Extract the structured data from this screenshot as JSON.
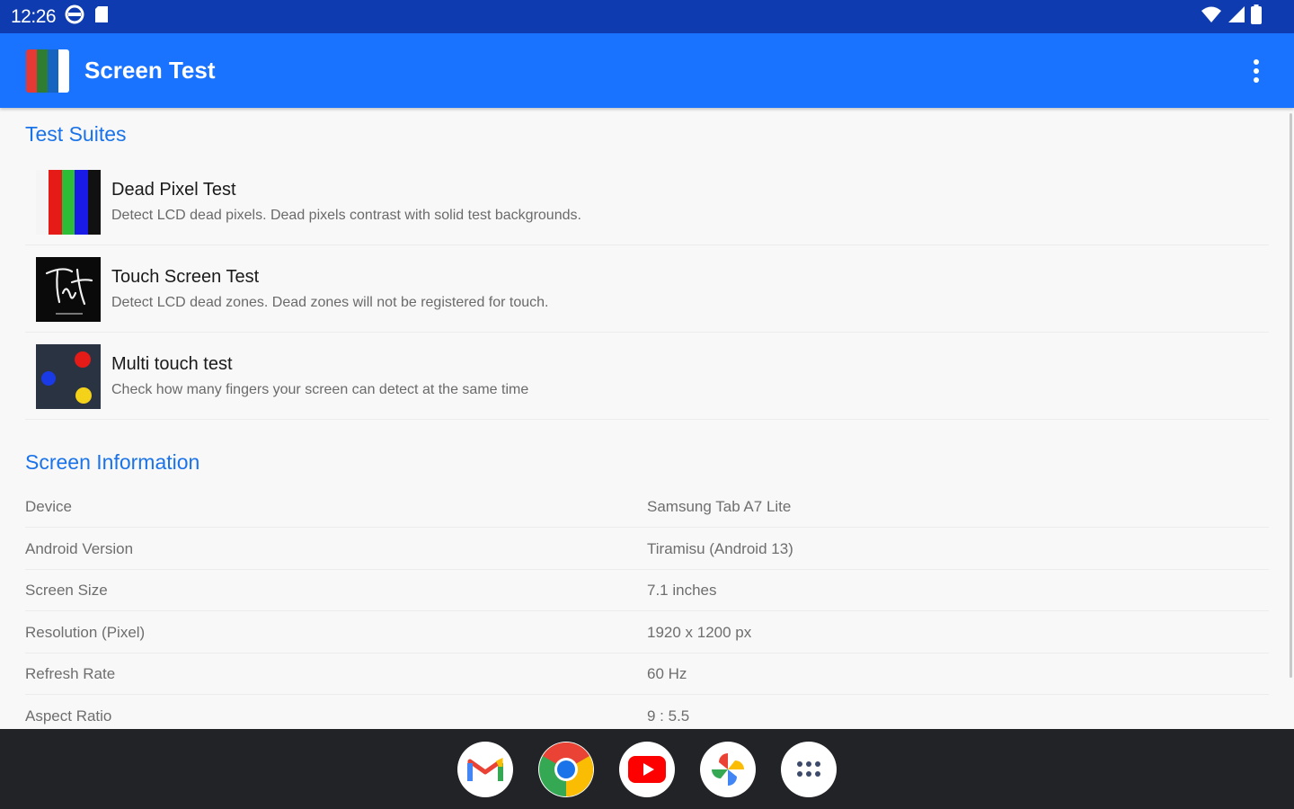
{
  "status_bar": {
    "time": "12:26"
  },
  "app_bar": {
    "title": "Screen Test",
    "logo_colors": [
      "#e53935",
      "#2e7d32",
      "#1565c0",
      "#ffffff"
    ]
  },
  "test_suites": {
    "header": "Test Suites",
    "items": [
      {
        "title": "Dead Pixel Test",
        "description": "Detect LCD dead pixels. Dead pixels contrast with solid test backgrounds.",
        "icon": "color-bars-icon"
      },
      {
        "title": "Touch Screen Test",
        "description": "Detect LCD dead zones. Dead zones will not be registered for touch.",
        "icon": "handwriting-icon"
      },
      {
        "title": "Multi touch test",
        "description": "Check how many fingers your screen can detect at the same time",
        "icon": "multi-dot-icon"
      }
    ]
  },
  "screen_information": {
    "header": "Screen Information",
    "rows": [
      {
        "label": "Device",
        "value": "Samsung Tab A7 Lite"
      },
      {
        "label": "Android Version",
        "value": "Tiramisu (Android 13)"
      },
      {
        "label": "Screen Size",
        "value": "7.1 inches"
      },
      {
        "label": "Resolution (Pixel)",
        "value": "1920 x 1200 px"
      },
      {
        "label": "Refresh Rate",
        "value": "60 Hz"
      },
      {
        "label": "Aspect Ratio",
        "value": "9 : 5.5"
      }
    ]
  },
  "dock": {
    "apps": [
      {
        "name": "gmail-icon"
      },
      {
        "name": "chrome-icon"
      },
      {
        "name": "youtube-icon"
      },
      {
        "name": "photos-icon"
      },
      {
        "name": "app-drawer-icon"
      }
    ]
  },
  "colors": {
    "status_bar": "#0f3bb0",
    "app_bar": "#1a73ff",
    "accent": "#1a73e8",
    "nav_bar": "#222326"
  }
}
